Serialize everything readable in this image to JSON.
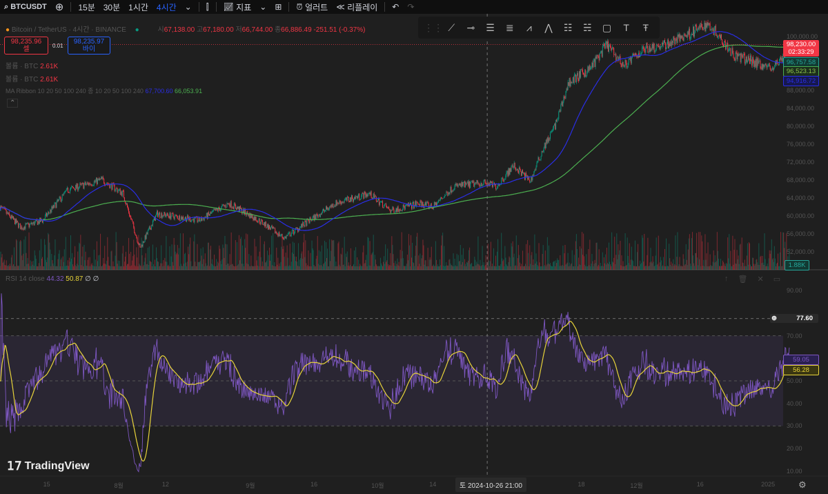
{
  "toolbar": {
    "symbol": "BTCUSDT",
    "intervals": [
      "15분",
      "30분",
      "1시간",
      "4시간"
    ],
    "active_interval": "4시간",
    "indicators": "지표",
    "alert": "얼러트",
    "replay": "리플레이"
  },
  "legend": {
    "title": "Bitcoin / TetherUS · 4시간 · BINANCE",
    "open_label": "시",
    "open": "67,138.00",
    "high_label": "고",
    "high": "67,180.00",
    "low_label": "저",
    "low": "66,744.00",
    "close_label": "종",
    "close": "66,886.49",
    "change": "-251.51 (-0.37%)",
    "sell_price": "98,235.96",
    "sell_label": "셀",
    "spread": "0.01",
    "buy_price": "98,235.97",
    "buy_label": "바이",
    "volume_rows": [
      {
        "label": "볼륨 · BTC",
        "value": "2.61K"
      },
      {
        "label": "볼륨 · BTC",
        "value": "2.61K"
      }
    ],
    "ma_label": "MA Ribbon 10 20 50 100 240 종 10 20 50 100 240",
    "ma_value_1": "67,700.60",
    "ma_value_2": "66,053.91",
    "rsi_label": "RSI 14 close",
    "rsi_value": "44.32",
    "rsi_ma_value": "50.87",
    "rsi_na": "∅ ∅"
  },
  "colors": {
    "up": "#089981",
    "down": "#f23645",
    "ma_fast": "#2a2ee6",
    "ma_slow": "#4caf50",
    "rsi": "#7e57c2",
    "rsi_ma": "#e8d43a",
    "background": "#1f1f1f"
  },
  "drawing_tools": [
    "trend-line",
    "horizontal-ray",
    "parallel-channel",
    "fib-retracement",
    "xabcd-pattern-15",
    "abcd-pattern",
    "long-position",
    "short-position",
    "rectangle",
    "text",
    "anchored-text"
  ],
  "price_axis": {
    "ticks": [
      "100,000.00",
      "88,000.00",
      "84,000.00",
      "80,000.00",
      "76,000.00",
      "72,000.00",
      "68,000.00",
      "64,000.00",
      "60,000.00",
      "56,000.00",
      "52,000.00"
    ],
    "tick_values": [
      100000,
      88000,
      84000,
      80000,
      76000,
      72000,
      68000,
      64000,
      60000,
      56000,
      52000
    ],
    "last_price": "98,230.00",
    "countdown": "02:33:29",
    "ma1": "96,757.58",
    "ma2": "96,523.13",
    "ma3": "94,916.72",
    "volume": "1.88K"
  },
  "rsi_axis": {
    "ticks": [
      "90.00",
      "70.00",
      "50.00",
      "40.00",
      "30.00",
      "20.00",
      "10.00"
    ],
    "tick_values": [
      90,
      70,
      50,
      40,
      30,
      20,
      10
    ],
    "crosshair": "77.60",
    "rsi_last": "59.05",
    "rsi_ma_last": "56.28"
  },
  "time_axis": {
    "labels": [
      "15",
      "8월",
      "12",
      "9월",
      "16",
      "10월",
      "14",
      "18",
      "12월",
      "16",
      "2025"
    ],
    "label_dates": [
      "2024-07-15",
      "2024-08-01",
      "2024-08-12",
      "2024-09-01",
      "2024-09-16",
      "2024-10-01",
      "2024-10-14",
      "2024-11-18",
      "2024-12-01",
      "2024-12-16",
      "2025-01-01"
    ],
    "crosshair": "토 2024-10-26   21:00"
  },
  "brand": "TradingView",
  "chart_data": {
    "type": "candlestick",
    "symbol": "BTCUSDT",
    "interval": "4h",
    "x_range": [
      "2024-07-04",
      "2025-01-06"
    ],
    "ylim": [
      50000,
      104000
    ],
    "grid": false,
    "close_path": [
      [
        "2024-07-04",
        62000
      ],
      [
        "2024-07-09",
        57400
      ],
      [
        "2024-07-14",
        59000
      ],
      [
        "2024-07-20",
        65800
      ],
      [
        "2024-07-28",
        68100
      ],
      [
        "2024-08-02",
        65000
      ],
      [
        "2024-08-06",
        52800
      ],
      [
        "2024-08-10",
        60500
      ],
      [
        "2024-08-20",
        59000
      ],
      [
        "2024-08-27",
        62800
      ],
      [
        "2024-09-03",
        59000
      ],
      [
        "2024-09-09",
        55100
      ],
      [
        "2024-09-15",
        59000
      ],
      [
        "2024-09-21",
        62800
      ],
      [
        "2024-09-29",
        65000
      ],
      [
        "2024-10-04",
        61200
      ],
      [
        "2024-10-11",
        62800
      ],
      [
        "2024-10-14",
        62000
      ],
      [
        "2024-10-19",
        66600
      ],
      [
        "2024-10-26",
        67400
      ],
      [
        "2024-10-29",
        66600
      ],
      [
        "2024-11-02",
        71200
      ],
      [
        "2024-11-06",
        67800
      ],
      [
        "2024-11-09",
        75000
      ],
      [
        "2024-11-12",
        80500
      ],
      [
        "2024-11-15",
        89700
      ],
      [
        "2024-11-20",
        92800
      ],
      [
        "2024-11-24",
        98200
      ],
      [
        "2024-11-28",
        93500
      ],
      [
        "2024-12-03",
        97400
      ],
      [
        "2024-12-08",
        98200
      ],
      [
        "2024-12-13",
        100500
      ],
      [
        "2024-12-18",
        102800
      ],
      [
        "2024-12-21",
        99700
      ],
      [
        "2024-12-24",
        95800
      ],
      [
        "2024-12-29",
        94300
      ],
      [
        "2025-01-02",
        92800
      ],
      [
        "2025-01-06",
        97400
      ]
    ],
    "rsi": {
      "period": 14,
      "ylim": [
        0,
        100
      ],
      "bands": [
        30,
        50,
        70
      ]
    }
  }
}
